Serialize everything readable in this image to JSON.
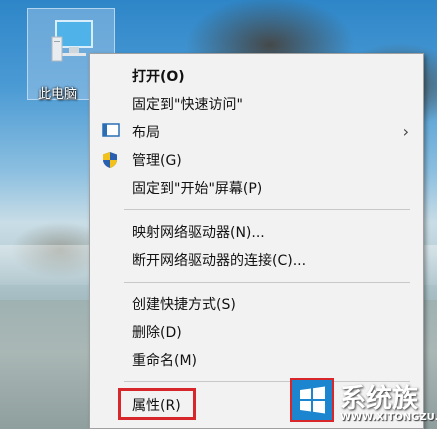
{
  "desktop": {
    "icon_label": "此电脑"
  },
  "context_menu": {
    "items": [
      {
        "label": "打开(O)",
        "bold": true
      },
      {
        "label": "固定到\"快速访问\""
      },
      {
        "label": "布局",
        "icon": "layout-icon",
        "submenu": true
      },
      {
        "label": "管理(G)",
        "icon": "uac-shield-icon"
      },
      {
        "label": "固定到\"开始\"屏幕(P)"
      },
      {
        "label": "映射网络驱动器(N)..."
      },
      {
        "label": "断开网络驱动器的连接(C)..."
      },
      {
        "label": "创建快捷方式(S)"
      },
      {
        "label": "删除(D)"
      },
      {
        "label": "重命名(M)"
      },
      {
        "label": "属性(R)",
        "highlighted": true
      }
    ],
    "submenu_arrow": "›",
    "highlight_color": "#d7272a"
  },
  "watermark": {
    "text": "系统族",
    "url": "WWW.XITONGZU.COM"
  }
}
